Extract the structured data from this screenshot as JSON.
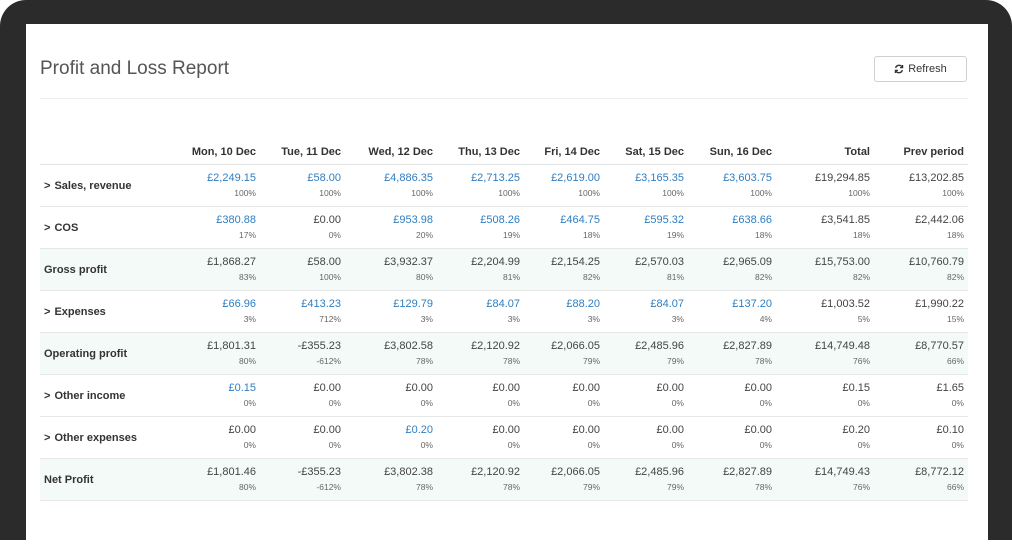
{
  "report": {
    "title": "Profit and Loss Report",
    "refresh_label": "Refresh"
  },
  "columns": [
    "Mon, 10 Dec",
    "Tue, 11 Dec",
    "Wed, 12 Dec",
    "Thu, 13 Dec",
    "Fri, 14 Dec",
    "Sat, 15 Dec",
    "Sun, 16 Dec",
    "Total",
    "Prev period"
  ],
  "colors": {
    "link": "#2f7ec2",
    "total_row_bg": "#f4faf8"
  },
  "rows": [
    {
      "label": "Sales, revenue",
      "expandable": true,
      "total": false,
      "cells": [
        {
          "v": "£2,249.15",
          "p": "100%",
          "link": true
        },
        {
          "v": "£58.00",
          "p": "100%",
          "link": true
        },
        {
          "v": "£4,886.35",
          "p": "100%",
          "link": true
        },
        {
          "v": "£2,713.25",
          "p": "100%",
          "link": true
        },
        {
          "v": "£2,619.00",
          "p": "100%",
          "link": true
        },
        {
          "v": "£3,165.35",
          "p": "100%",
          "link": true
        },
        {
          "v": "£3,603.75",
          "p": "100%",
          "link": true
        },
        {
          "v": "£19,294.85",
          "p": "100%",
          "link": false
        },
        {
          "v": "£13,202.85",
          "p": "100%",
          "link": false
        }
      ]
    },
    {
      "label": "COS",
      "expandable": true,
      "total": false,
      "cells": [
        {
          "v": "£380.88",
          "p": "17%",
          "link": true
        },
        {
          "v": "£0.00",
          "p": "0%",
          "link": false
        },
        {
          "v": "£953.98",
          "p": "20%",
          "link": true
        },
        {
          "v": "£508.26",
          "p": "19%",
          "link": true
        },
        {
          "v": "£464.75",
          "p": "18%",
          "link": true
        },
        {
          "v": "£595.32",
          "p": "19%",
          "link": true
        },
        {
          "v": "£638.66",
          "p": "18%",
          "link": true
        },
        {
          "v": "£3,541.85",
          "p": "18%",
          "link": false
        },
        {
          "v": "£2,442.06",
          "p": "18%",
          "link": false
        }
      ]
    },
    {
      "label": "Gross profit",
      "expandable": false,
      "total": true,
      "cells": [
        {
          "v": "£1,868.27",
          "p": "83%",
          "link": false
        },
        {
          "v": "£58.00",
          "p": "100%",
          "link": false
        },
        {
          "v": "£3,932.37",
          "p": "80%",
          "link": false
        },
        {
          "v": "£2,204.99",
          "p": "81%",
          "link": false
        },
        {
          "v": "£2,154.25",
          "p": "82%",
          "link": false
        },
        {
          "v": "£2,570.03",
          "p": "81%",
          "link": false
        },
        {
          "v": "£2,965.09",
          "p": "82%",
          "link": false
        },
        {
          "v": "£15,753.00",
          "p": "82%",
          "link": false
        },
        {
          "v": "£10,760.79",
          "p": "82%",
          "link": false
        }
      ]
    },
    {
      "label": "Expenses",
      "expandable": true,
      "total": false,
      "cells": [
        {
          "v": "£66.96",
          "p": "3%",
          "link": true
        },
        {
          "v": "£413.23",
          "p": "712%",
          "link": true
        },
        {
          "v": "£129.79",
          "p": "3%",
          "link": true
        },
        {
          "v": "£84.07",
          "p": "3%",
          "link": true
        },
        {
          "v": "£88.20",
          "p": "3%",
          "link": true
        },
        {
          "v": "£84.07",
          "p": "3%",
          "link": true
        },
        {
          "v": "£137.20",
          "p": "4%",
          "link": true
        },
        {
          "v": "£1,003.52",
          "p": "5%",
          "link": false
        },
        {
          "v": "£1,990.22",
          "p": "15%",
          "link": false
        }
      ]
    },
    {
      "label": "Operating profit",
      "expandable": false,
      "total": true,
      "cells": [
        {
          "v": "£1,801.31",
          "p": "80%",
          "link": false
        },
        {
          "v": "-£355.23",
          "p": "-612%",
          "link": false
        },
        {
          "v": "£3,802.58",
          "p": "78%",
          "link": false
        },
        {
          "v": "£2,120.92",
          "p": "78%",
          "link": false
        },
        {
          "v": "£2,066.05",
          "p": "79%",
          "link": false
        },
        {
          "v": "£2,485.96",
          "p": "79%",
          "link": false
        },
        {
          "v": "£2,827.89",
          "p": "78%",
          "link": false
        },
        {
          "v": "£14,749.48",
          "p": "76%",
          "link": false
        },
        {
          "v": "£8,770.57",
          "p": "66%",
          "link": false
        }
      ]
    },
    {
      "label": "Other income",
      "expandable": true,
      "total": false,
      "cells": [
        {
          "v": "£0.15",
          "p": "0%",
          "link": true
        },
        {
          "v": "£0.00",
          "p": "0%",
          "link": false
        },
        {
          "v": "£0.00",
          "p": "0%",
          "link": false
        },
        {
          "v": "£0.00",
          "p": "0%",
          "link": false
        },
        {
          "v": "£0.00",
          "p": "0%",
          "link": false
        },
        {
          "v": "£0.00",
          "p": "0%",
          "link": false
        },
        {
          "v": "£0.00",
          "p": "0%",
          "link": false
        },
        {
          "v": "£0.15",
          "p": "0%",
          "link": false
        },
        {
          "v": "£1.65",
          "p": "0%",
          "link": false
        }
      ]
    },
    {
      "label": "Other expenses",
      "expandable": true,
      "total": false,
      "cells": [
        {
          "v": "£0.00",
          "p": "0%",
          "link": false
        },
        {
          "v": "£0.00",
          "p": "0%",
          "link": false
        },
        {
          "v": "£0.20",
          "p": "0%",
          "link": true
        },
        {
          "v": "£0.00",
          "p": "0%",
          "link": false
        },
        {
          "v": "£0.00",
          "p": "0%",
          "link": false
        },
        {
          "v": "£0.00",
          "p": "0%",
          "link": false
        },
        {
          "v": "£0.00",
          "p": "0%",
          "link": false
        },
        {
          "v": "£0.20",
          "p": "0%",
          "link": false
        },
        {
          "v": "£0.10",
          "p": "0%",
          "link": false
        }
      ]
    },
    {
      "label": "Net Profit",
      "expandable": false,
      "total": true,
      "cells": [
        {
          "v": "£1,801.46",
          "p": "80%",
          "link": false
        },
        {
          "v": "-£355.23",
          "p": "-612%",
          "link": false
        },
        {
          "v": "£3,802.38",
          "p": "78%",
          "link": false
        },
        {
          "v": "£2,120.92",
          "p": "78%",
          "link": false
        },
        {
          "v": "£2,066.05",
          "p": "79%",
          "link": false
        },
        {
          "v": "£2,485.96",
          "p": "79%",
          "link": false
        },
        {
          "v": "£2,827.89",
          "p": "78%",
          "link": false
        },
        {
          "v": "£14,749.43",
          "p": "76%",
          "link": false
        },
        {
          "v": "£8,772.12",
          "p": "66%",
          "link": false
        }
      ]
    }
  ]
}
